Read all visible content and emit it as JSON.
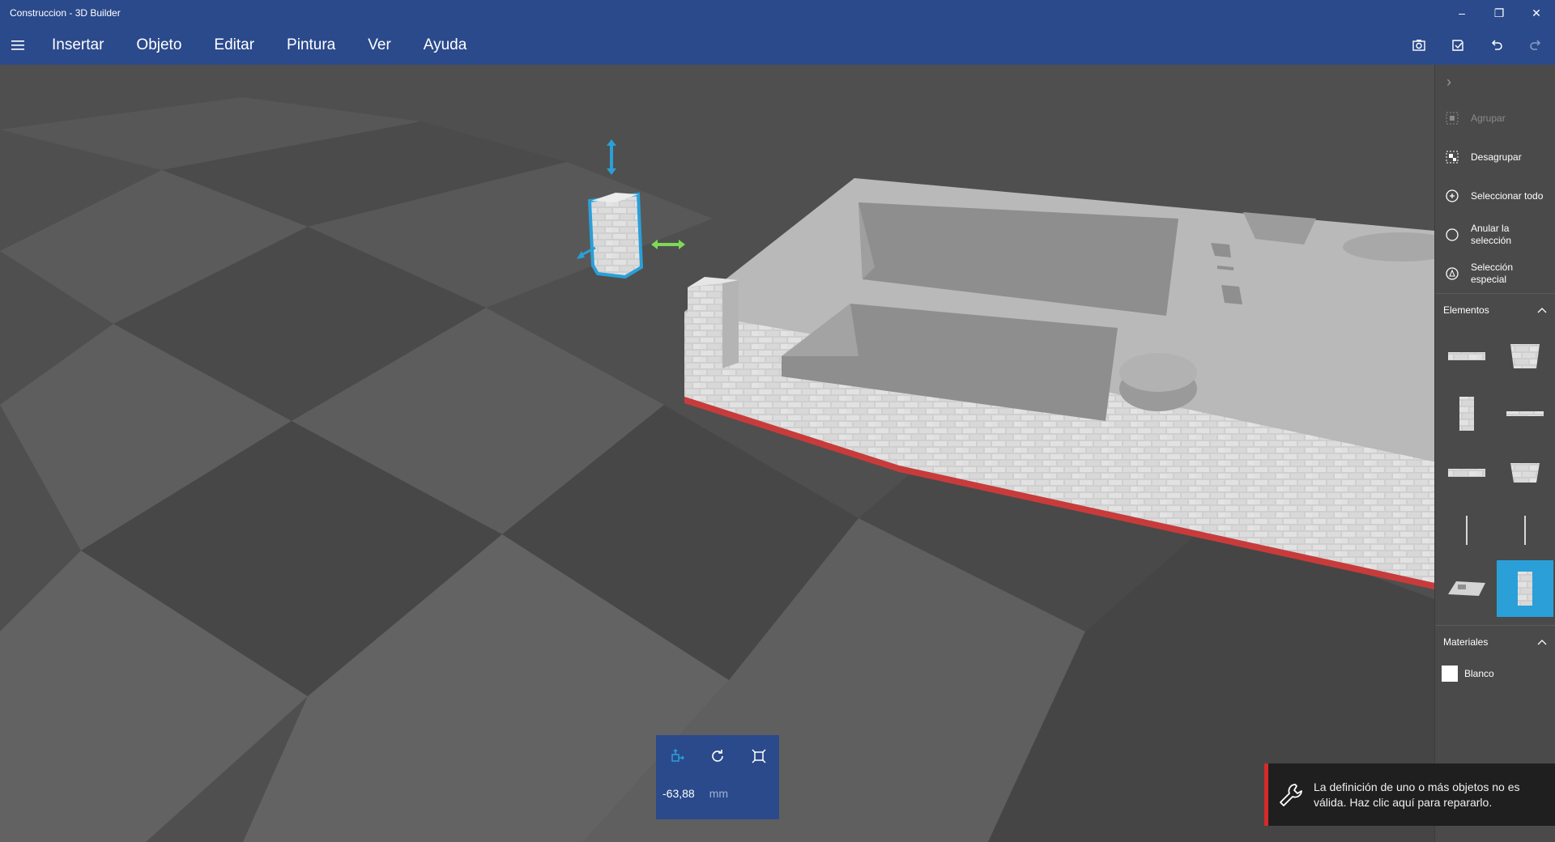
{
  "window": {
    "title": "Construccion - 3D Builder",
    "controls": {
      "minimize": "–",
      "restore": "❐",
      "close": "✕"
    }
  },
  "menubar": {
    "items": [
      "Insertar",
      "Objeto",
      "Editar",
      "Pintura",
      "Ver",
      "Ayuda"
    ],
    "icons": [
      "hamburger-icon",
      "screenshot-icon",
      "export-icon",
      "undo-icon",
      "redo-icon"
    ]
  },
  "panel": {
    "collapse_icon": "›",
    "commands": [
      {
        "label": "Agrupar",
        "icon": "group-icon",
        "disabled": true
      },
      {
        "label": "Desagrupar",
        "icon": "ungroup-icon",
        "disabled": false
      },
      {
        "label": "Seleccionar todo",
        "icon": "select-all-icon",
        "disabled": false
      },
      {
        "label": "Anular la selección",
        "icon": "deselect-icon",
        "disabled": false
      },
      {
        "label": "Selección especial",
        "icon": "special-select-icon",
        "disabled": false
      }
    ],
    "elements_header": "Elementos",
    "materials_header": "Materiales",
    "material": {
      "name": "Blanco",
      "color": "#ffffff"
    },
    "selected_thumb_color": "#2a9fd8"
  },
  "transform": {
    "value": "-63,88",
    "unit": "mm",
    "icons": [
      "move-icon",
      "rotate-icon",
      "scale-icon"
    ]
  },
  "toast": {
    "message": "La definición de uno o más objetos no es válida. Haz clic aquí para repararlo.",
    "icon": "wrench-icon",
    "accent": "#d62a2a"
  },
  "colors": {
    "titlebar": "#2b4a8c",
    "accent": "#2a9fd8",
    "gizmo_green": "#7ed957"
  }
}
